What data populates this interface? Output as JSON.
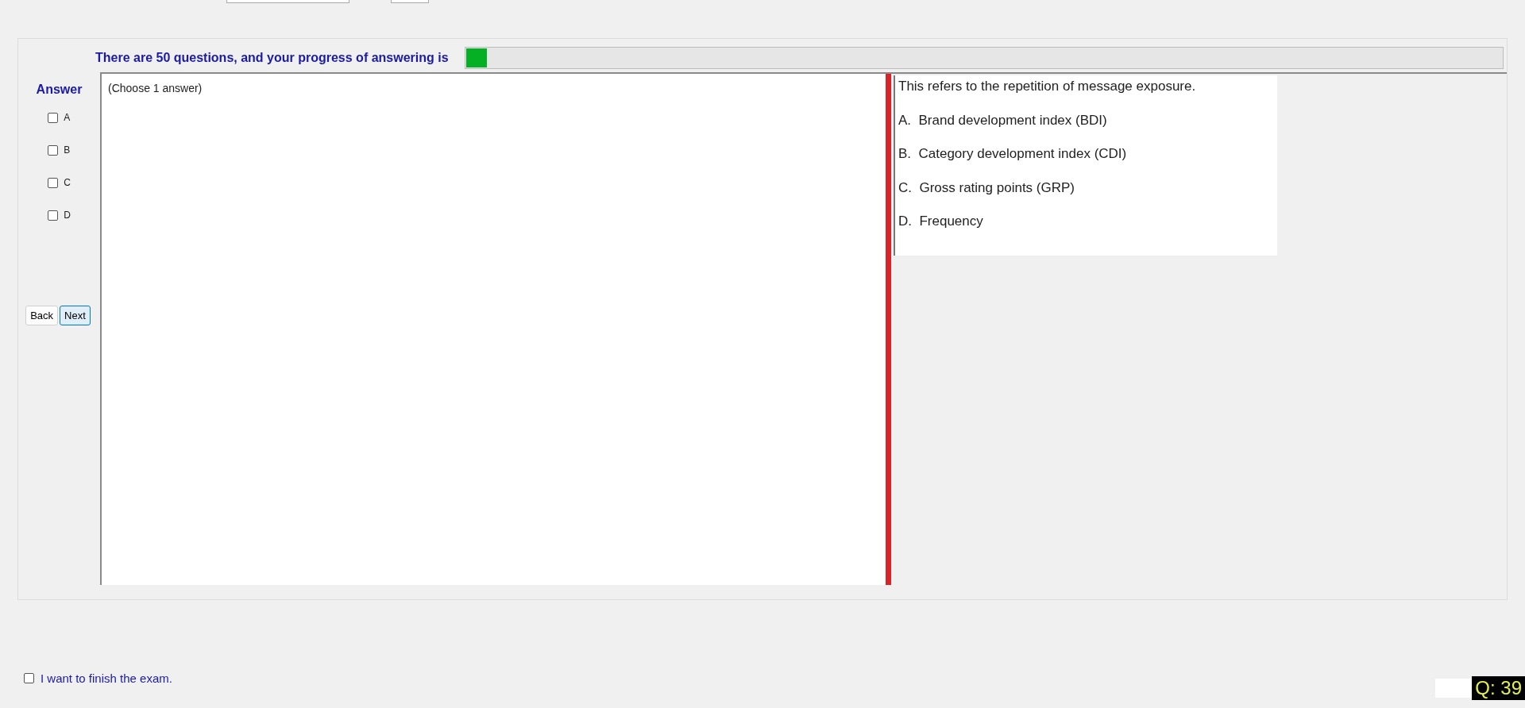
{
  "progress": {
    "label": "There are 50 questions, and your progress of answering is",
    "level": 0.02
  },
  "answer": {
    "title": "Answer",
    "options": [
      {
        "label": "A",
        "checked": false
      },
      {
        "label": "B",
        "checked": false
      },
      {
        "label": "C",
        "checked": false
      },
      {
        "label": "D",
        "checked": false
      }
    ]
  },
  "navigation": {
    "buttons": [
      {
        "label": "Back",
        "selected": false
      },
      {
        "label": "Next",
        "selected": true
      }
    ]
  },
  "answer_panel": {
    "instruction": "(Choose 1 answer)"
  },
  "question": {
    "text": "This refers to the repetition of message exposure.",
    "choices": [
      "A.  Brand development index (BDI)",
      "B.  Category development index (CDI)",
      "C.  Gross rating points (GRP)",
      "D.  Frequency"
    ]
  },
  "finish": {
    "label": "I want to finish the exam.",
    "checked": false
  },
  "question_number": "Q: 39"
}
